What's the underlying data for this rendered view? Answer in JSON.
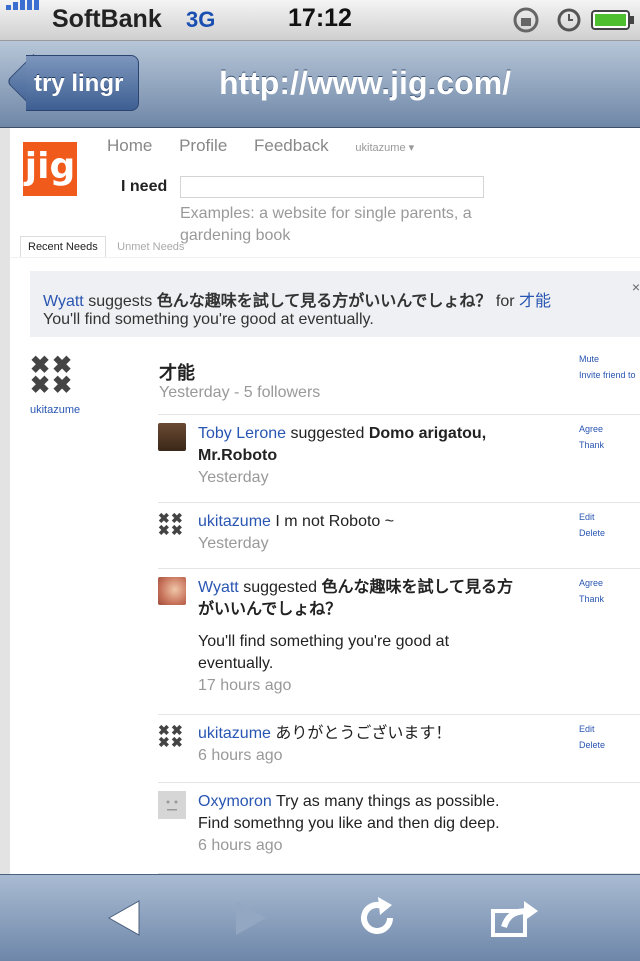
{
  "status": {
    "carrier": "SoftBank",
    "network": "3G",
    "time": "17:12"
  },
  "nav": {
    "back_label": "try lingr",
    "title": "http://www.jig.com/"
  },
  "site": {
    "logo_text": "jig",
    "menu": [
      "Home",
      "Profile",
      "Feedback"
    ],
    "user_menu": "ukitazume ▾",
    "need_label": "I need",
    "need_placeholder": "",
    "examples": "Examples: a website for single parents, a gardening book",
    "tabs": [
      "Recent Needs",
      "Unmet Needs"
    ]
  },
  "banner": {
    "user": "Wyatt",
    "verb": "suggests",
    "suggestion": "色んな趣味を試して見る方がいいんでしょね？",
    "for_word": "for",
    "for_target": "才能",
    "detail": "You'll find something you're good at eventually.",
    "close": "×"
  },
  "need": {
    "owner": "ukitazume",
    "title": "才能",
    "meta": "Yesterday - 5 followers",
    "actions": [
      "Mute",
      "Invite friend to"
    ]
  },
  "entries": [
    {
      "user": "Toby Lerone",
      "verb": "suggested",
      "bold_line1": "Domo arigatou,",
      "bold_line2": "Mr.Roboto",
      "time": "Yesterday",
      "actions": [
        "Agree",
        "Thank"
      ]
    },
    {
      "user": "ukitazume",
      "text": "I m not Roboto ~",
      "time": "Yesterday",
      "actions": [
        "Edit",
        "Delete"
      ]
    },
    {
      "user": "Wyatt",
      "verb": "suggested",
      "bold_line1": "色んな趣味を試して見る方",
      "bold_line2": "がいいんでしょね？",
      "body_line1": "You'll find something you're good at",
      "body_line2": "eventually.",
      "time": "17 hours ago",
      "actions": [
        "Agree",
        "Thank"
      ]
    },
    {
      "user": "ukitazume",
      "text": "ありがとうございます！",
      "time": "6 hours ago",
      "actions": [
        "Edit",
        "Delete"
      ]
    },
    {
      "user": "Oxymoron",
      "text_line1": "Try as many things as possible.",
      "text_line2": "Find somethng you like and then dig deep.",
      "time": "6 hours ago"
    }
  ],
  "icons": {
    "back": "left-arrow-icon",
    "forward": "right-arrow-icon",
    "reload": "reload-icon",
    "share": "share-icon"
  },
  "colors": {
    "logo": "#f05a1a",
    "link": "#2956b2",
    "navbar": "#6f87a7"
  }
}
